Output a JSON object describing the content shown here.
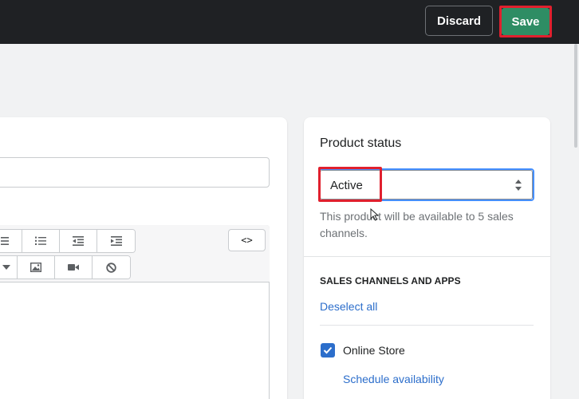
{
  "header": {
    "discard_label": "Discard",
    "save_label": "Save"
  },
  "editor": {
    "toolbar_row1": [
      "bulleted-list-icon",
      "numbered-list-icon",
      "outdent-icon",
      "indent-icon"
    ],
    "toolbar_row2": [
      "dropdown-caret-icon",
      "image-icon",
      "video-icon",
      "clear-formatting-icon"
    ],
    "html_toggle_label": "<>"
  },
  "product_status": {
    "title": "Product status",
    "selected_value": "Active",
    "help_text": "This product will be available to 5 sales channels."
  },
  "sales_channels": {
    "heading": "SALES CHANNELS AND APPS",
    "deselect_label": "Deselect all",
    "channels": [
      {
        "label": "Online Store",
        "checked": true,
        "schedule_label": "Schedule availability"
      }
    ]
  },
  "colors": {
    "topbar": "#1f2124",
    "save_button": "#2e8d64",
    "highlight": "#e0202e",
    "link": "#2c6ecb",
    "focus_ring": "#458fff"
  }
}
